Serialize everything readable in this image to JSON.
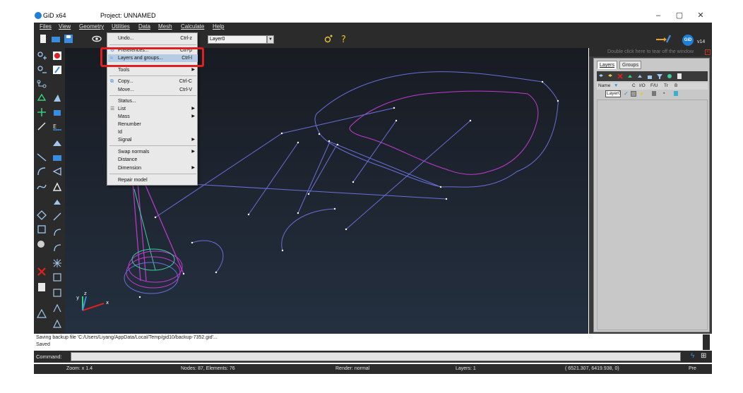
{
  "window": {
    "app_title": "GiD x64",
    "project_title": "Project: UNNAMED",
    "controls": [
      "–",
      "▢",
      "✕"
    ]
  },
  "menubar": [
    "Files",
    "View",
    "Geometry",
    "Utilities",
    "Data",
    "Mesh",
    "Calculate",
    "Help"
  ],
  "toolbar": {
    "layer_select": "Layer0",
    "version": "v14",
    "logo_text": "GiD"
  },
  "utilities_menu": {
    "undo": {
      "label": "Undo...",
      "shortcut": "Ctrl-z"
    },
    "preferences": {
      "label": "Preferences...",
      "shortcut": "Ctrl-p"
    },
    "layers_groups": {
      "label": "Layers and groups...",
      "shortcut": "Ctrl-l"
    },
    "tools": {
      "label": "Tools"
    },
    "copy": {
      "label": "Copy...",
      "shortcut": "Ctrl-C"
    },
    "move": {
      "label": "Move...",
      "shortcut": "Ctrl-V"
    },
    "status": {
      "label": "Status..."
    },
    "list": {
      "label": "List"
    },
    "mass": {
      "label": "Mass"
    },
    "renumber": {
      "label": "Renumber"
    },
    "id": {
      "label": "Id"
    },
    "signal": {
      "label": "Signal"
    },
    "swap_normals": {
      "label": "Swap normals"
    },
    "distance": {
      "label": "Distance"
    },
    "dimension": {
      "label": "Dimension"
    },
    "repair_model": {
      "label": "Repair model"
    }
  },
  "layers_panel": {
    "tearoff_text": "Double click here to tear off the window",
    "tabs": [
      "Layers",
      "Groups"
    ],
    "columns": {
      "name": "Name",
      "c": "C",
      "io": "I/O",
      "fu": "F/U",
      "tr": "Tr",
      "b": "B"
    },
    "rows": [
      {
        "name": "Layer0"
      }
    ]
  },
  "messages": {
    "line1": "Saving backup file 'C:/Users/Liyang/AppData/Local/Temp/gid10/backup-7352.gid'...",
    "line2": "Saved"
  },
  "command": {
    "label": "Command:",
    "value": ""
  },
  "statusbar": {
    "zoom": "Zoom: x 1.4",
    "nodes": "Nodes: 87, Elements: 76",
    "render": "Render: normal",
    "layers": "Layers: 1",
    "coords": "( 6521.307, 6419.938, 0)",
    "mode": "Pre"
  },
  "axes_labels": {
    "y": "y",
    "z": "z",
    "x": "x"
  },
  "colors": {
    "chrome": "#2b2b2b",
    "highlight_box": "#e02020",
    "menu_hover": "#b5cce4",
    "geometry_lines": "#6a6fd8",
    "magenta_lines": "#c23ad0"
  }
}
